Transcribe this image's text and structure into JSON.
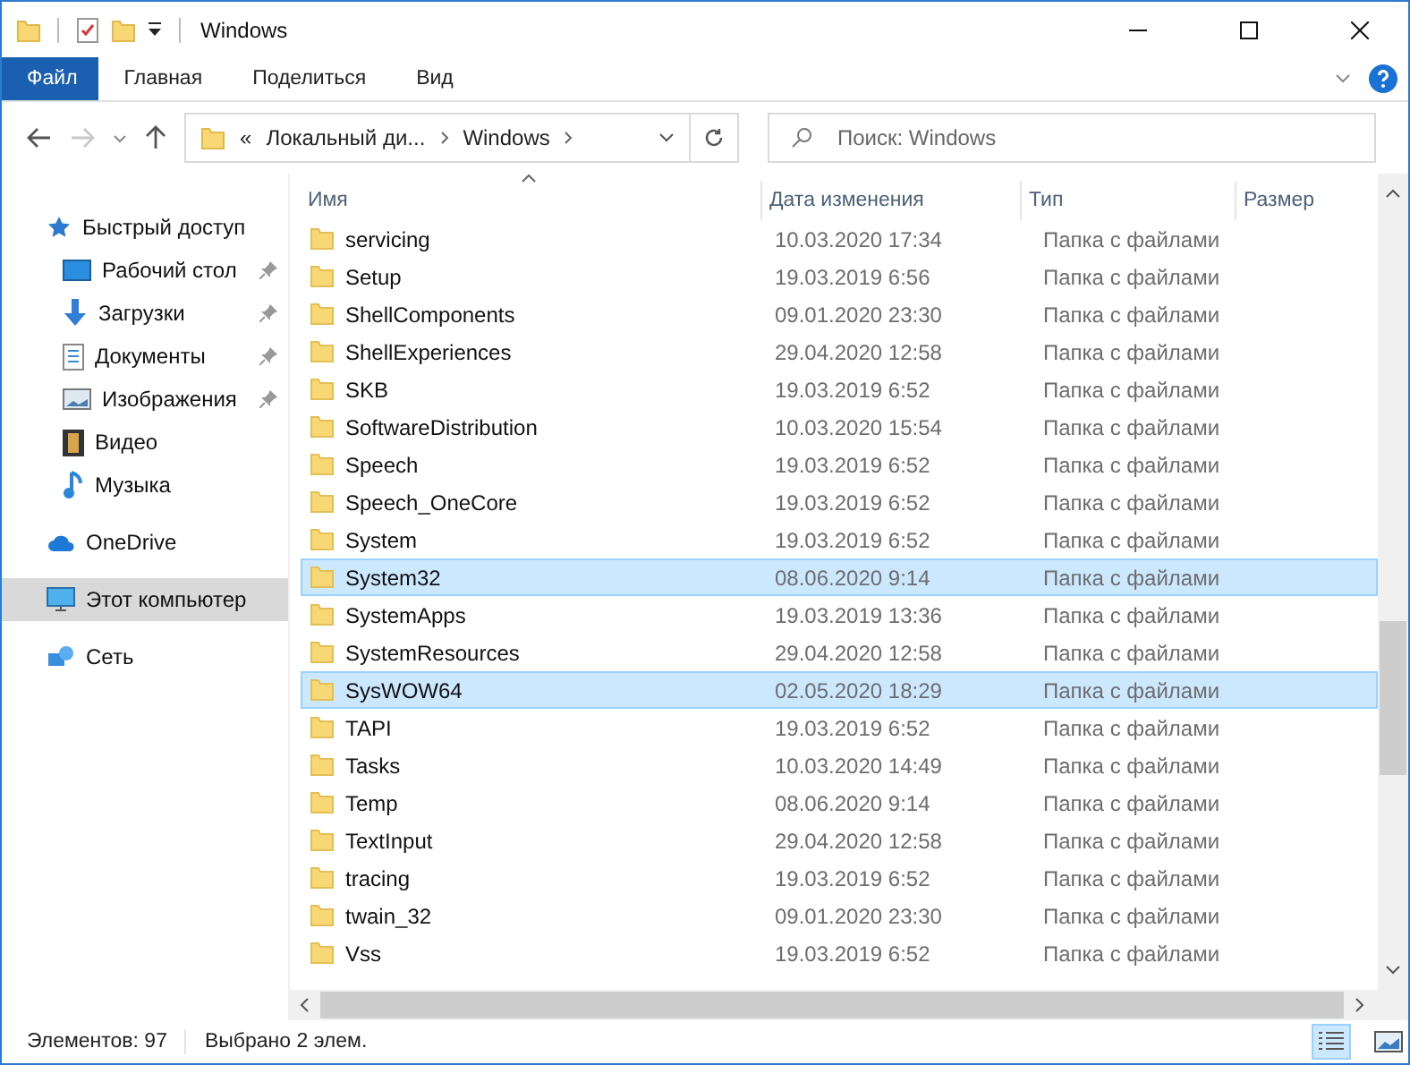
{
  "window": {
    "title": "Windows"
  },
  "ribbon": {
    "tabs": [
      {
        "label": "Файл",
        "selected": true
      },
      {
        "label": "Главная",
        "selected": false
      },
      {
        "label": "Поделиться",
        "selected": false
      },
      {
        "label": "Вид",
        "selected": false
      }
    ]
  },
  "address": {
    "overflow": "«",
    "crumbs": [
      "Локальный ди...",
      "Windows"
    ]
  },
  "search": {
    "placeholder": "Поиск: Windows"
  },
  "sidebar": {
    "items": [
      {
        "label": "Быстрый доступ",
        "kind": "star",
        "selected": false,
        "children": [
          {
            "label": "Рабочий стол",
            "kind": "desktop",
            "pinned": true,
            "selected": false
          },
          {
            "label": "Загрузки",
            "kind": "download",
            "pinned": true,
            "selected": false
          },
          {
            "label": "Документы",
            "kind": "documents",
            "pinned": true,
            "selected": false
          },
          {
            "label": "Изображения",
            "kind": "pictures",
            "pinned": true,
            "selected": false
          },
          {
            "label": "Видео",
            "kind": "video",
            "pinned": false,
            "selected": false
          },
          {
            "label": "Музыка",
            "kind": "music",
            "pinned": false,
            "selected": false
          }
        ]
      },
      {
        "label": "OneDrive",
        "kind": "cloud",
        "selected": false
      },
      {
        "label": "Этот компьютер",
        "kind": "computer",
        "selected": true
      },
      {
        "label": "Сеть",
        "kind": "network",
        "selected": false
      }
    ]
  },
  "table": {
    "columns": [
      "Имя",
      "Дата изменения",
      "Тип",
      "Размер"
    ],
    "rows": [
      {
        "name": "servicing",
        "date": "10.03.2020 17:34",
        "type": "Папка с файлами",
        "selected": false
      },
      {
        "name": "Setup",
        "date": "19.03.2019 6:56",
        "type": "Папка с файлами",
        "selected": false
      },
      {
        "name": "ShellComponents",
        "date": "09.01.2020 23:30",
        "type": "Папка с файлами",
        "selected": false
      },
      {
        "name": "ShellExperiences",
        "date": "29.04.2020 12:58",
        "type": "Папка с файлами",
        "selected": false
      },
      {
        "name": "SKB",
        "date": "19.03.2019 6:52",
        "type": "Папка с файлами",
        "selected": false
      },
      {
        "name": "SoftwareDistribution",
        "date": "10.03.2020 15:54",
        "type": "Папка с файлами",
        "selected": false
      },
      {
        "name": "Speech",
        "date": "19.03.2019 6:52",
        "type": "Папка с файлами",
        "selected": false
      },
      {
        "name": "Speech_OneCore",
        "date": "19.03.2019 6:52",
        "type": "Папка с файлами",
        "selected": false
      },
      {
        "name": "System",
        "date": "19.03.2019 6:52",
        "type": "Папка с файлами",
        "selected": false
      },
      {
        "name": "System32",
        "date": "08.06.2020 9:14",
        "type": "Папка с файлами",
        "selected": true
      },
      {
        "name": "SystemApps",
        "date": "19.03.2019 13:36",
        "type": "Папка с файлами",
        "selected": false
      },
      {
        "name": "SystemResources",
        "date": "29.04.2020 12:58",
        "type": "Папка с файлами",
        "selected": false
      },
      {
        "name": "SysWOW64",
        "date": "02.05.2020 18:29",
        "type": "Папка с файлами",
        "selected": true
      },
      {
        "name": "TAPI",
        "date": "19.03.2019 6:52",
        "type": "Папка с файлами",
        "selected": false
      },
      {
        "name": "Tasks",
        "date": "10.03.2020 14:49",
        "type": "Папка с файлами",
        "selected": false
      },
      {
        "name": "Temp",
        "date": "08.06.2020 9:14",
        "type": "Папка с файлами",
        "selected": false
      },
      {
        "name": "TextInput",
        "date": "29.04.2020 12:58",
        "type": "Папка с файлами",
        "selected": false
      },
      {
        "name": "tracing",
        "date": "19.03.2019 6:52",
        "type": "Папка с файлами",
        "selected": false
      },
      {
        "name": "twain_32",
        "date": "09.01.2020 23:30",
        "type": "Папка с файлами",
        "selected": false
      },
      {
        "name": "Vss",
        "date": "19.03.2019 6:52",
        "type": "Папка с файлами",
        "selected": false
      }
    ]
  },
  "status_bar": {
    "count": "Элементов: 97",
    "selection": "Выбрано 2 элем.",
    "views": [
      {
        "kind": "details",
        "selected": true
      },
      {
        "kind": "preview",
        "selected": false
      }
    ]
  }
}
